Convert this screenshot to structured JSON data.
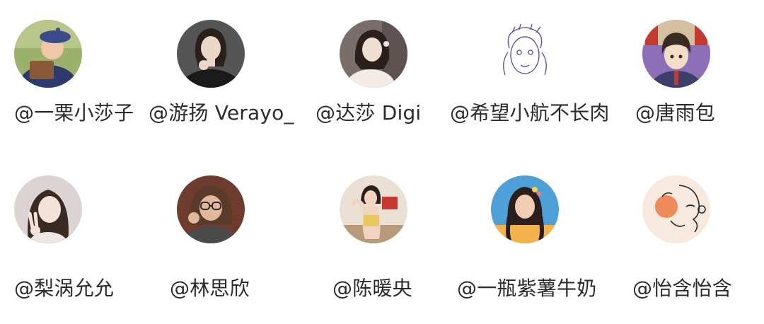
{
  "users": [
    {
      "handle": "@一栗小莎子",
      "avatar_icon": "avatar-photo-girl-beret",
      "bg": "#8aa35a",
      "accent": "#3b4a8a"
    },
    {
      "handle": "@游扬 Verayo_",
      "avatar_icon": "avatar-photo-woman-dark",
      "bg": "#5a5a5a",
      "accent": "#e9d3c4"
    },
    {
      "handle": "@达莎 Digi",
      "avatar_icon": "avatar-photo-woman-flowers",
      "bg": "#7b6d68",
      "accent": "#f1dfd4"
    },
    {
      "handle": "@希望小航不长肉",
      "avatar_icon": "avatar-sketch-face",
      "bg": "#ffffff",
      "accent": "#5b55a0"
    },
    {
      "handle": "@唐雨包",
      "avatar_icon": "avatar-anime-boy",
      "bg": "#8d6fb8",
      "accent": "#c33b2f"
    },
    {
      "handle": "@梨涡允允",
      "avatar_icon": "avatar-photo-girl-peace-sign",
      "bg": "#d9cfcf",
      "accent": "#3a2a24"
    },
    {
      "handle": "@林思欣",
      "avatar_icon": "avatar-photo-girl-glasses",
      "bg": "#6d3c2f",
      "accent": "#d9a789"
    },
    {
      "handle": "@陈暖央",
      "avatar_icon": "avatar-photo-girl-room",
      "bg": "#e6d6c4",
      "accent": "#c73a34"
    },
    {
      "handle": "@一瓶紫薯牛奶",
      "avatar_icon": "avatar-photo-girl-sky",
      "bg": "#4fa0d8",
      "accent": "#f3b24b"
    },
    {
      "handle": "@怡含怡含",
      "avatar_icon": "avatar-illustration-peach",
      "bg": "#f7e9de",
      "accent": "#ef8a5a"
    }
  ]
}
